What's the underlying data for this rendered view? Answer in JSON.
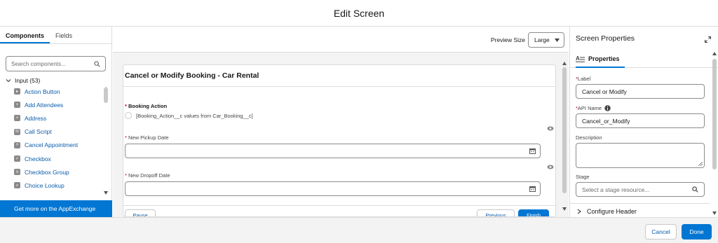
{
  "title": "Edit Screen",
  "left_panel": {
    "tabs": [
      "Components",
      "Fields"
    ],
    "search_placeholder": "Search components...",
    "group_label": "Input (53)",
    "components": [
      {
        "label": "Action Button",
        "icon": "action-button-icon"
      },
      {
        "label": "Add Attendees",
        "icon": "add-attendees-icon"
      },
      {
        "label": "Address",
        "icon": "address-icon"
      },
      {
        "label": "Call Script",
        "icon": "call-script-icon"
      },
      {
        "label": "Cancel Appointment",
        "icon": "cancel-appointment-icon"
      },
      {
        "label": "Checkbox",
        "icon": "checkbox-icon"
      },
      {
        "label": "Checkbox Group",
        "icon": "checkbox-group-icon"
      },
      {
        "label": "Choice Lookup",
        "icon": "choice-lookup-icon"
      }
    ],
    "appexchange_label": "Get more on the AppExchange"
  },
  "canvas": {
    "preview_size_label": "Preview Size",
    "preview_size_value": "Large",
    "card_title": "Cancel or Modify Booking - Car Rental",
    "booking_action_label": "Booking Action",
    "booking_action_placeholder": "[Booking_Action__c values from Car_Booking__c]",
    "pickup_label": "New Pickup Date",
    "dropoff_label": "New Dropoff Date",
    "buttons": {
      "pause": "Pause",
      "previous": "Previous",
      "finish": "Finish"
    }
  },
  "right_panel": {
    "header": "Screen Properties",
    "tab": "Properties",
    "label_label": "Label",
    "label_value": "Cancel or Modify",
    "api_name_label": "API Name",
    "api_name_value": "Cancel_or_Modify",
    "description_label": "Description",
    "stage_label": "Stage",
    "stage_placeholder": "Select a stage resource...",
    "configure_header": "Configure Header"
  },
  "footer": {
    "cancel": "Cancel",
    "done": "Done"
  },
  "colors": {
    "brand": "#0176d3",
    "link": "#0b5cab",
    "required": "#ba0517",
    "border": "#dcdcdc"
  }
}
